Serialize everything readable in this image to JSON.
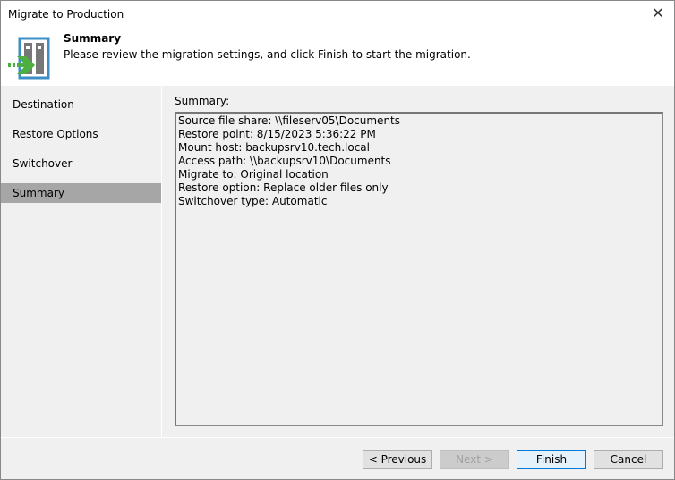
{
  "window": {
    "title": "Migrate to Production"
  },
  "header": {
    "title": "Summary",
    "description": "Please review the migration settings, and click Finish to start the migration."
  },
  "nav": {
    "items": [
      {
        "label": "Destination"
      },
      {
        "label": "Restore Options"
      },
      {
        "label": "Switchover"
      },
      {
        "label": "Summary",
        "selected": true
      }
    ]
  },
  "main": {
    "summary_label": "Summary:",
    "summary_lines": [
      "Source file share: \\\\fileserv05\\Documents",
      "Restore point: 8/15/2023 5:36:22 PM",
      "Mount host: backupsrv10.tech.local",
      "Access path: \\\\backupsrv10\\Documents",
      "Migrate to: Original location",
      "Restore option: Replace older files only",
      "Switchover type: Automatic"
    ]
  },
  "buttons": {
    "previous": "< Previous",
    "next": "Next >",
    "finish": "Finish",
    "cancel": "Cancel"
  },
  "colors": {
    "accent": "#0078d7",
    "logo_blue": "#3b8fc4",
    "logo_green": "#4caf3f"
  }
}
